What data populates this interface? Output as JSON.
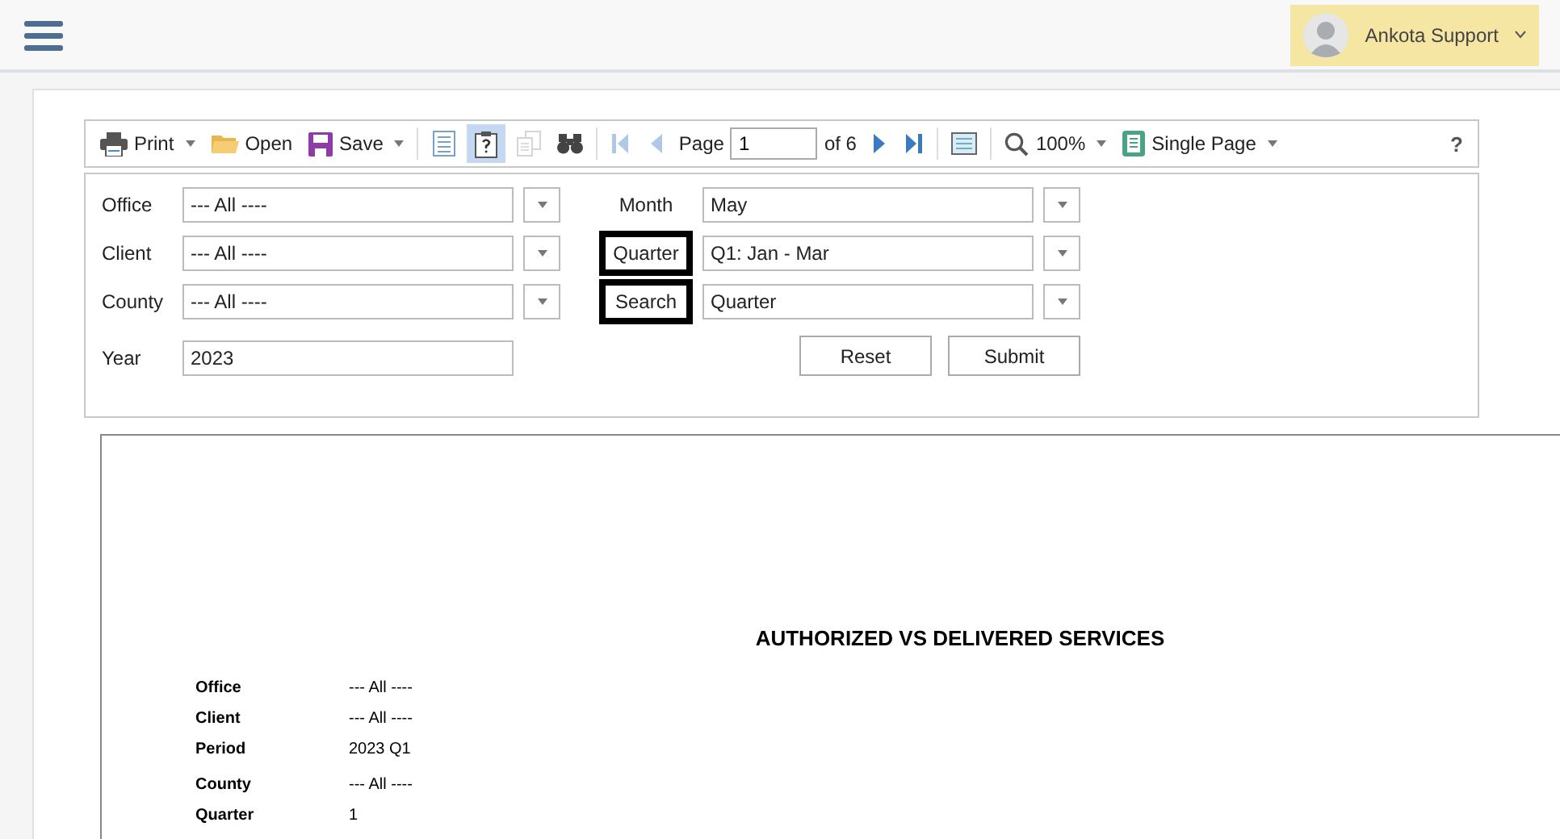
{
  "header": {
    "user": "Ankota Support"
  },
  "toolbar": {
    "print": "Print",
    "open": "Open",
    "save": "Save",
    "views": [
      {
        "selected": false,
        "disabled": false
      },
      {
        "selected": true,
        "disabled": false
      },
      {
        "selected": false,
        "disabled": true
      }
    ],
    "back_nav": [
      {
        "disabled": true
      },
      {
        "disabled": true
      }
    ],
    "page_label": "Page",
    "page_value": "1",
    "page_count": "of 6",
    "forward_nav": [
      {
        "disabled": false
      },
      {
        "disabled": false
      }
    ],
    "zoom": "100%",
    "view_mode": "Single Page",
    "help": "?"
  },
  "filters_left": [
    {
      "label": "Office",
      "value": "--- All ----",
      "kind": "select"
    },
    {
      "label": "Client",
      "value": "--- All ----",
      "kind": "select"
    },
    {
      "label": "County",
      "value": "--- All ----",
      "kind": "select"
    },
    {
      "label": "Year",
      "value": "2023",
      "kind": "text"
    }
  ],
  "filters_right": [
    {
      "label": "Month",
      "value": "May",
      "highlighted": false
    },
    {
      "label": "Quarter",
      "value": "Q1: Jan - Mar",
      "highlighted": true
    },
    {
      "label": "Search",
      "value": "Quarter",
      "highlighted": true
    }
  ],
  "buttons": [
    "Reset",
    "Submit"
  ],
  "report": {
    "title": "AUTHORIZED VS DELIVERED SERVICES",
    "params": [
      {
        "label": "Office",
        "value": "--- All ----"
      },
      {
        "label": "Client",
        "value": "--- All ----"
      },
      {
        "label": "Period",
        "value": "2023 Q1"
      },
      {
        "label": "County",
        "value": "--- All ----"
      },
      {
        "label": "Quarter",
        "value": "1"
      }
    ]
  }
}
